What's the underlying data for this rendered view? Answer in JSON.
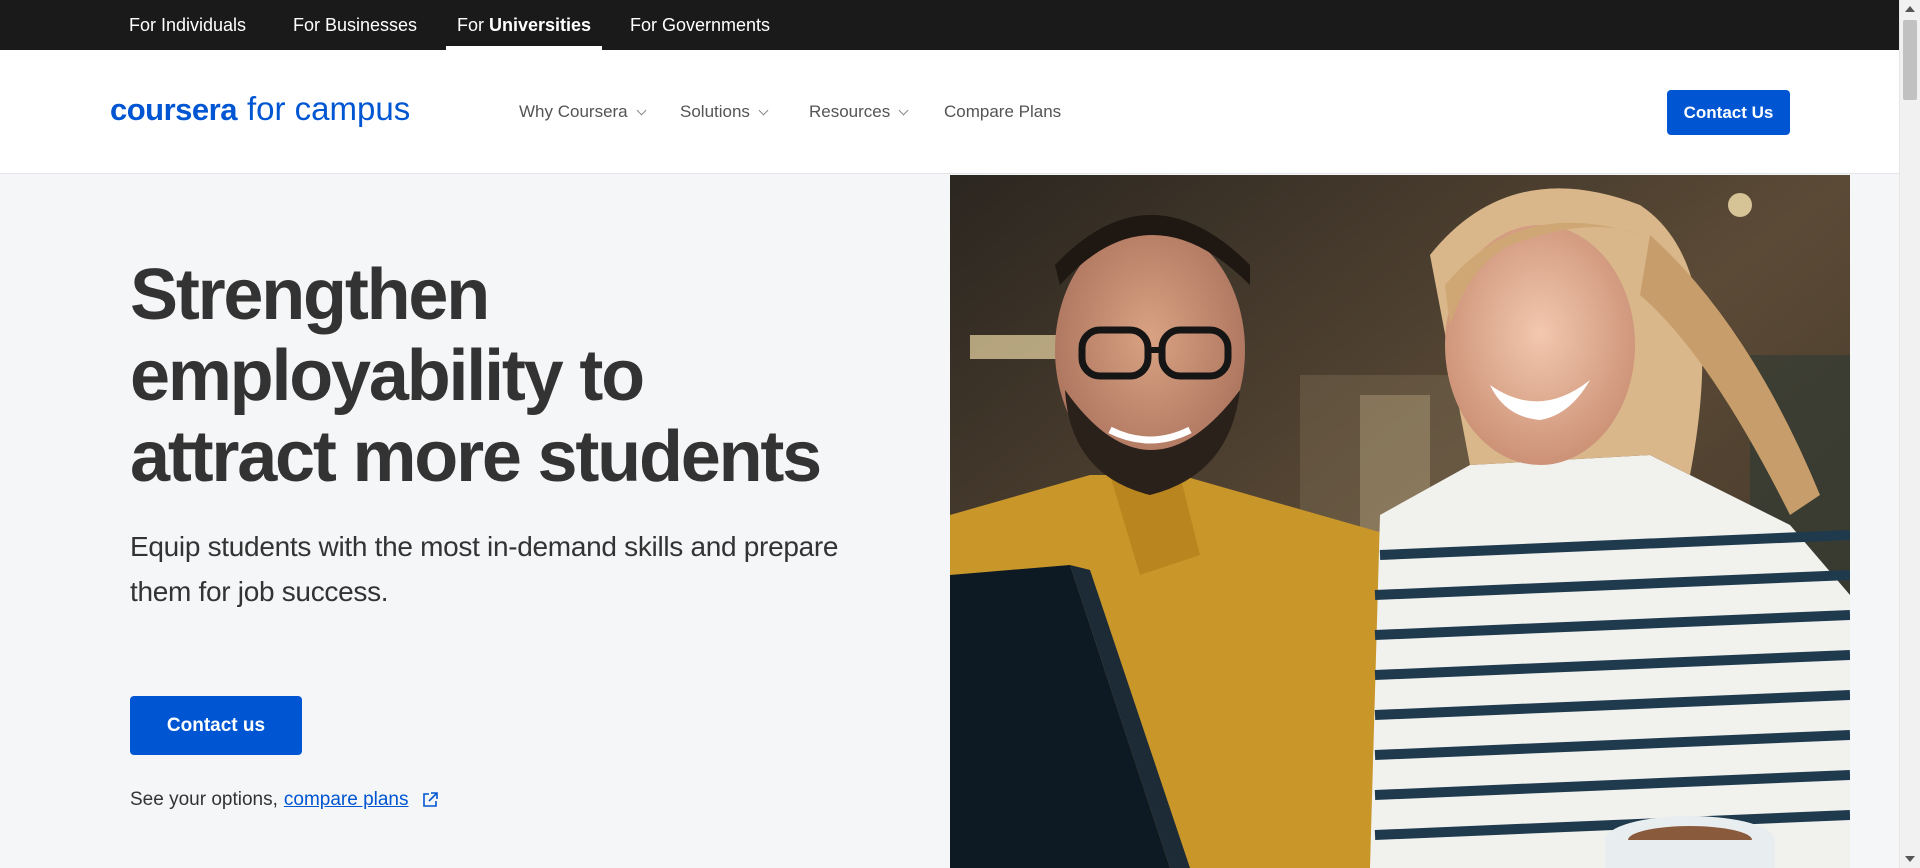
{
  "topbar": {
    "items": [
      {
        "label": "For Individuals"
      },
      {
        "label": "For Businesses"
      },
      {
        "prefix": "For ",
        "bold": "Universities",
        "active": true
      },
      {
        "label": "For Governments"
      }
    ]
  },
  "header": {
    "logo_brand": "coursera",
    "logo_sub": "for campus",
    "nav": [
      {
        "label": "Why Coursera"
      },
      {
        "label": "Solutions"
      },
      {
        "label": "Resources"
      },
      {
        "label": "Compare Plans"
      }
    ],
    "contact_label": "Contact Us"
  },
  "hero": {
    "title_lines": [
      "Strengthen",
      "employability to",
      "attract more students"
    ],
    "subtitle_lines": [
      "Equip students with the most in-demand skills and prepare",
      "them for job success."
    ],
    "cta_label": "Contact us",
    "options_prefix": "See your options,",
    "options_link": "compare plans"
  },
  "colors": {
    "brand_blue": "#0056d2",
    "topbar_bg": "#1a1a1a",
    "page_bg": "#f5f6f8"
  },
  "icons": {
    "external_link": "external-link-icon",
    "chevron": "chevron-down-icon"
  }
}
